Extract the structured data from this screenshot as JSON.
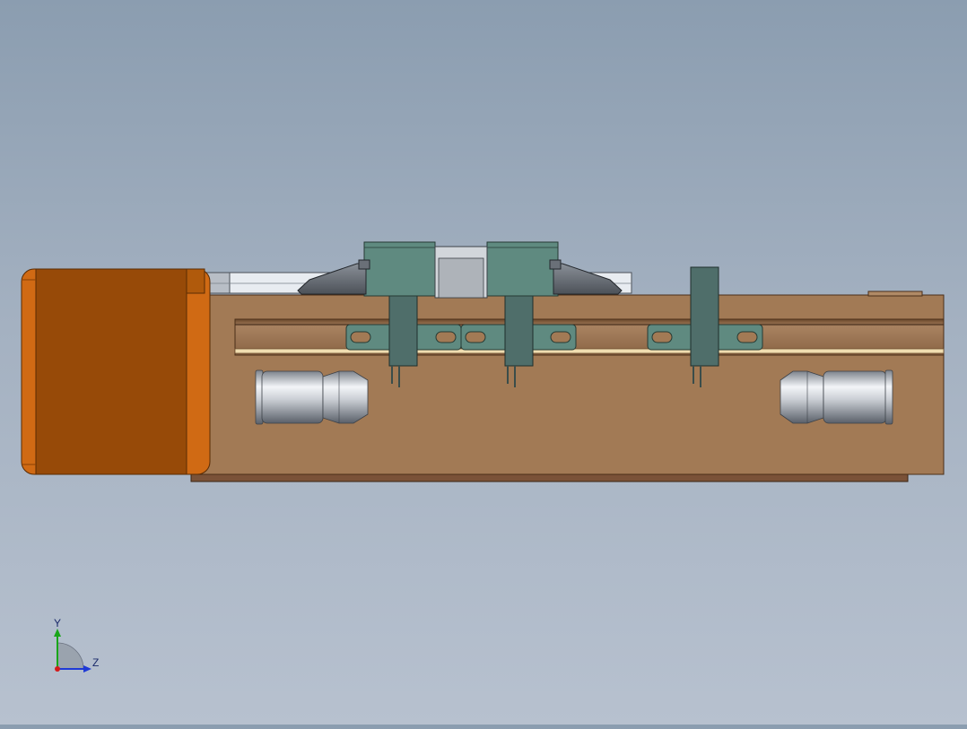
{
  "view": {
    "background_top": "#8b9db0",
    "background_bottom": "#b7c1cf"
  },
  "model": {
    "motor_color": "#974a08",
    "motor_edge_color": "#d06a14",
    "body_color": "#a27a55",
    "body_edge_color": "#5a3a20",
    "gripper_color": "#5f8a80",
    "finger_color": "#4f6e6a",
    "fitting_color": "#c8ccd2"
  },
  "triad": {
    "y_label": "Y",
    "z_label": "Z",
    "y_color": "#19a519",
    "z_color": "#1f3ad6",
    "origin_color": "#d41a1a"
  }
}
